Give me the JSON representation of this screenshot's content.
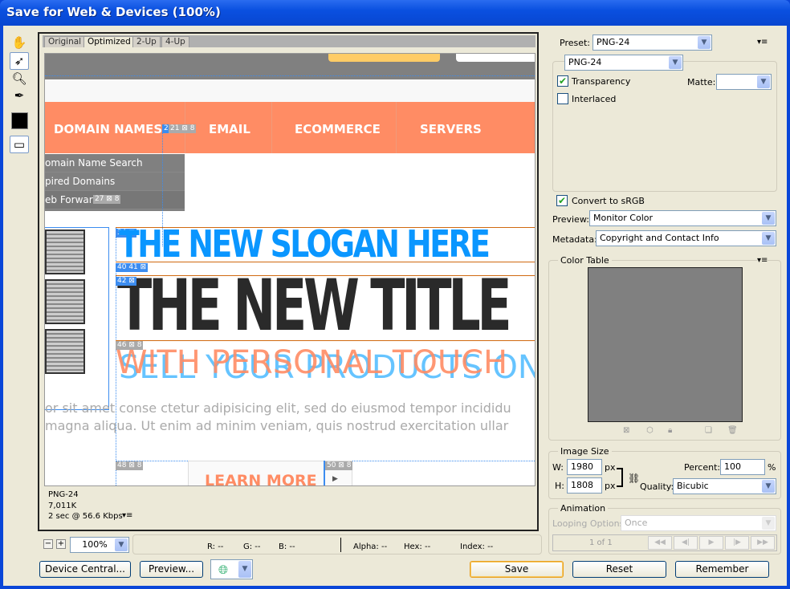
{
  "window": {
    "title": "Save for Web & Devices (100%)"
  },
  "tools": [
    "hand-tool",
    "slice-select-tool",
    "zoom-tool",
    "eyedropper-tool",
    "eyedropper-color",
    "toggle-slices-visibility"
  ],
  "view_tabs": [
    "Original",
    "Optimized",
    "2-Up",
    "4-Up"
  ],
  "canvas": {
    "nav": [
      "DOMAIN NAMES",
      "EMAIL",
      "ECOMMERCE",
      "SERVERS"
    ],
    "dropdown": [
      "omain Name Search",
      "pired Domains",
      "eb Forwarc"
    ],
    "slogan": "THE NEW SLOGAN HERE",
    "headline": "THE NEW TITLE",
    "sub_back": "SELL YOUR PRODUCTS ONL",
    "sub_front": "WITH PERSONAL TOUCH",
    "lorem": [
      "or sit amet conse ctetur adipisicing elit, sed do eiusmod tempor incididu",
      "magna aliqua. Ut enim ad minim veniam, quis nostrud exercitation ullar"
    ],
    "learn_more": "LEARN MORE",
    "slices": [
      "2",
      "21",
      "8",
      "2",
      "27",
      "8",
      "34",
      "3",
      "40 41",
      "42",
      "4",
      "46",
      "8",
      "48",
      "8",
      "50",
      "8",
      "3"
    ]
  },
  "info": {
    "format": "PNG-24",
    "size": "7,011K",
    "time": "2 sec @ 56.6 Kbps"
  },
  "zoom": {
    "value": "100%"
  },
  "status": {
    "r": "R: --",
    "g": "G: --",
    "b": "B: --",
    "alpha": "Alpha: --",
    "hex": "Hex: --",
    "index": "Index: --"
  },
  "buttons": {
    "device_central": "Device Central...",
    "preview": "Preview...",
    "save": "Save",
    "reset": "Reset",
    "remember": "Remember"
  },
  "settings": {
    "preset_label": "Preset:",
    "preset": "PNG-24",
    "format": "PNG-24",
    "transparency": "Transparency",
    "transparency_checked": true,
    "interlaced": "Interlaced",
    "interlaced_checked": false,
    "matte_label": "Matte:",
    "matte": "",
    "convert_srgb": "Convert to sRGB",
    "convert_checked": true,
    "preview_label": "Preview:",
    "preview": "Monitor Color",
    "metadata_label": "Metadata:",
    "metadata": "Copyright and Contact Info"
  },
  "color_table": {
    "title": "Color Table"
  },
  "image_size": {
    "title": "Image Size",
    "w_label": "W:",
    "w": "1980",
    "h_label": "H:",
    "h": "1808",
    "unit": "px",
    "percent_label": "Percent:",
    "percent": "100",
    "percent_unit": "%",
    "quality_label": "Quality:",
    "quality": "Bicubic"
  },
  "animation": {
    "title": "Animation",
    "looping_label": "Looping Options:",
    "looping": "Once",
    "frame": "1 of 1"
  },
  "colors": {
    "nav": "#ff8c64",
    "slogan": "#0a96ff",
    "accent_blue": "#0a46d8"
  }
}
